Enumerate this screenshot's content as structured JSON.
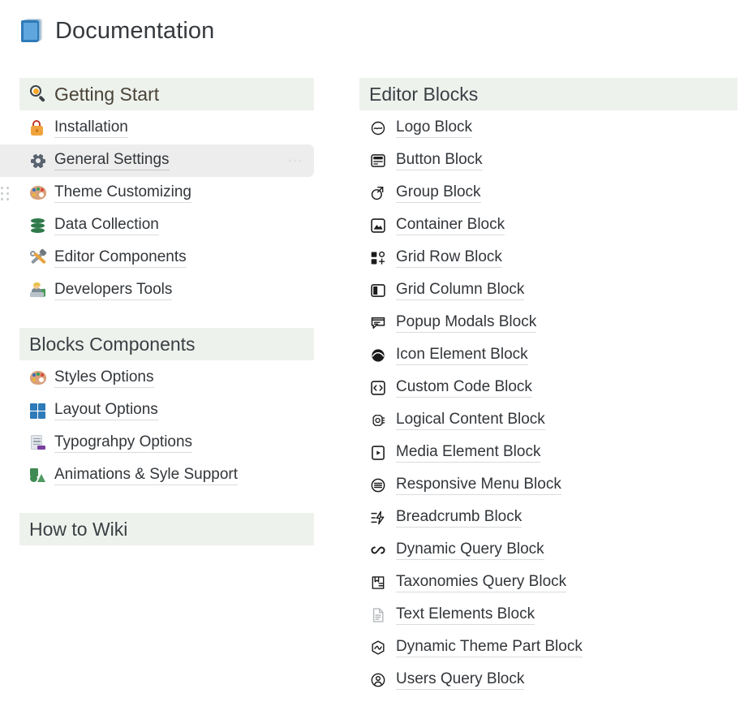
{
  "page": {
    "title": "Documentation",
    "title_icon": "closed-book-icon"
  },
  "left_column": {
    "sections": [
      {
        "id": "getting-start",
        "heading": "Getting Start",
        "heading_icon": "magnifying-glass-icon",
        "heading_style": "warm",
        "items": [
          {
            "label": "Installation",
            "icon": "unlocked-padlock-icon",
            "active": false,
            "draggable": false
          },
          {
            "label": "General Settings",
            "icon": "gear-icon",
            "active": true,
            "draggable": true
          },
          {
            "label": "Theme Customizing",
            "icon": "artist-palette-icon",
            "active": false,
            "draggable": true
          },
          {
            "label": "Data Collection",
            "icon": "database-icon",
            "active": false,
            "draggable": false
          },
          {
            "label": "Editor Components",
            "icon": "hammer-and-wrench-icon",
            "active": false,
            "draggable": false
          },
          {
            "label": "Developers Tools",
            "icon": "technologist-icon",
            "active": false,
            "draggable": false
          }
        ]
      },
      {
        "id": "blocks-components",
        "heading": "Blocks Components",
        "heading_icon": null,
        "heading_style": "cool",
        "items": [
          {
            "label": "Styles Options",
            "icon": "artist-palette-icon",
            "active": false,
            "draggable": false
          },
          {
            "label": "Layout Options",
            "icon": "layout-grid-icon",
            "active": false,
            "draggable": false
          },
          {
            "label": "Typograhpy Options",
            "icon": "typography-page-icon",
            "active": false,
            "draggable": false
          },
          {
            "label": "Animations & Syle Support",
            "icon": "animation-shapes-icon",
            "active": false,
            "draggable": false
          }
        ]
      },
      {
        "id": "how-to-wiki",
        "heading": "How to Wiki",
        "heading_icon": null,
        "heading_style": "cool",
        "items": []
      }
    ]
  },
  "right_column": {
    "sections": [
      {
        "id": "editor-blocks",
        "heading": "Editor Blocks",
        "heading_icon": null,
        "heading_style": "cool",
        "items": [
          {
            "label": "Logo Block",
            "icon": "logo-circle-icon"
          },
          {
            "label": "Button Block",
            "icon": "button-stack-icon"
          },
          {
            "label": "Group Block",
            "icon": "group-overlap-icon"
          },
          {
            "label": "Container Block",
            "icon": "container-image-icon"
          },
          {
            "label": "Grid Row Block",
            "icon": "grid-row-icon"
          },
          {
            "label": "Grid Column Block",
            "icon": "grid-column-icon"
          },
          {
            "label": "Popup Modals Block",
            "icon": "popup-modal-icon"
          },
          {
            "label": "Icon Element Block",
            "icon": "icon-element-circle-icon"
          },
          {
            "label": "Custom Code Block",
            "icon": "code-brackets-icon"
          },
          {
            "label": "Logical Content Block",
            "icon": "logic-gear-icon"
          },
          {
            "label": "Media Element Block",
            "icon": "media-play-icon"
          },
          {
            "label": "Responsive Menu Block",
            "icon": "hamburger-menu-circle-icon"
          },
          {
            "label": "Breadcrumb Block",
            "icon": "breadcrumb-bolt-icon"
          },
          {
            "label": "Dynamic Query Block",
            "icon": "infinity-loop-icon"
          },
          {
            "label": "Taxonomies Query Block",
            "icon": "taxonomy-tag-icon"
          },
          {
            "label": "Text Elements Block",
            "icon": "text-document-icon"
          },
          {
            "label": "Dynamic Theme Part Block",
            "icon": "pulse-hexagon-icon"
          },
          {
            "label": "Users Query Block",
            "icon": "user-circle-icon"
          }
        ]
      }
    ]
  },
  "colors": {
    "section_header_bg": "#eef2ec",
    "active_row_bg": "#ededed",
    "warm_heading_text": "#4a4338",
    "cool_heading_text": "#3a3f44",
    "link_text": "#32363a",
    "link_underline": "#d9dcdd",
    "page_title_text": "#35393d"
  }
}
